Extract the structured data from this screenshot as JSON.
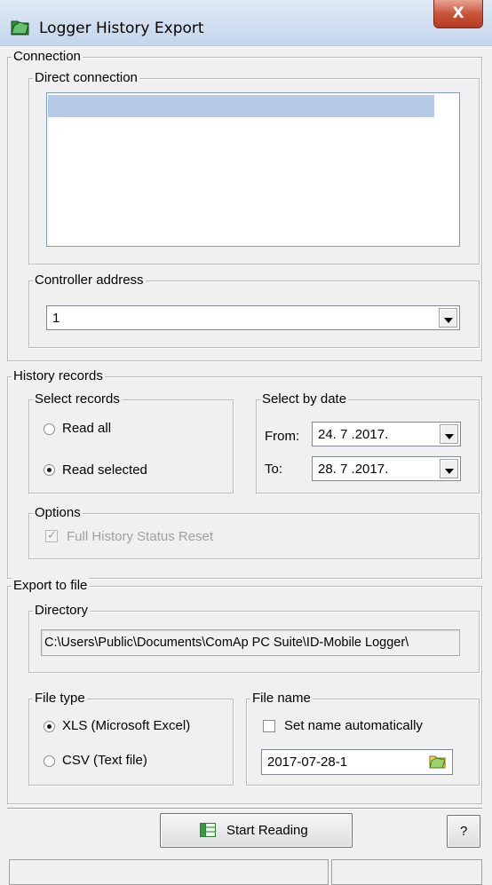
{
  "window": {
    "title": "Logger History Export",
    "close_glyph": "X",
    "app_icon": "logger-folder-icon"
  },
  "connection": {
    "label": "Connection",
    "direct": {
      "label": "Direct connection",
      "items": [
        ""
      ]
    },
    "controller_address": {
      "label": "Controller address",
      "value": "1"
    }
  },
  "history_records": {
    "label": "History records",
    "select_records": {
      "label": "Select records",
      "read_all": "Read all",
      "read_selected": "Read selected",
      "selected": "read_selected"
    },
    "select_by_date": {
      "label": "Select by date",
      "from_label": "From:",
      "from_value": "24. 7 .2017.",
      "to_label": "To:",
      "to_value": "28. 7 .2017."
    },
    "options": {
      "label": "Options",
      "full_history_reset": "Full History Status Reset",
      "full_history_reset_checked": true
    }
  },
  "export": {
    "label": "Export to file",
    "directory": {
      "label": "Directory",
      "value": "C:\\Users\\Public\\Documents\\ComAp PC Suite\\ID-Mobile Logger\\"
    },
    "file_type": {
      "label": "File type",
      "xls": "XLS  (Microsoft Excel)",
      "csv": "CSV  (Text file)",
      "selected": "xls"
    },
    "file_name": {
      "label": "File name",
      "auto_label": "Set name automatically",
      "auto_checked": false,
      "value": "2017-07-28-1"
    }
  },
  "footer": {
    "start_label": "Start Reading",
    "help_label": "?"
  },
  "colors": {
    "title_gradient_top": "#dfe9f5",
    "close_red": "#c9543a",
    "selection": "#b6c9e6"
  }
}
